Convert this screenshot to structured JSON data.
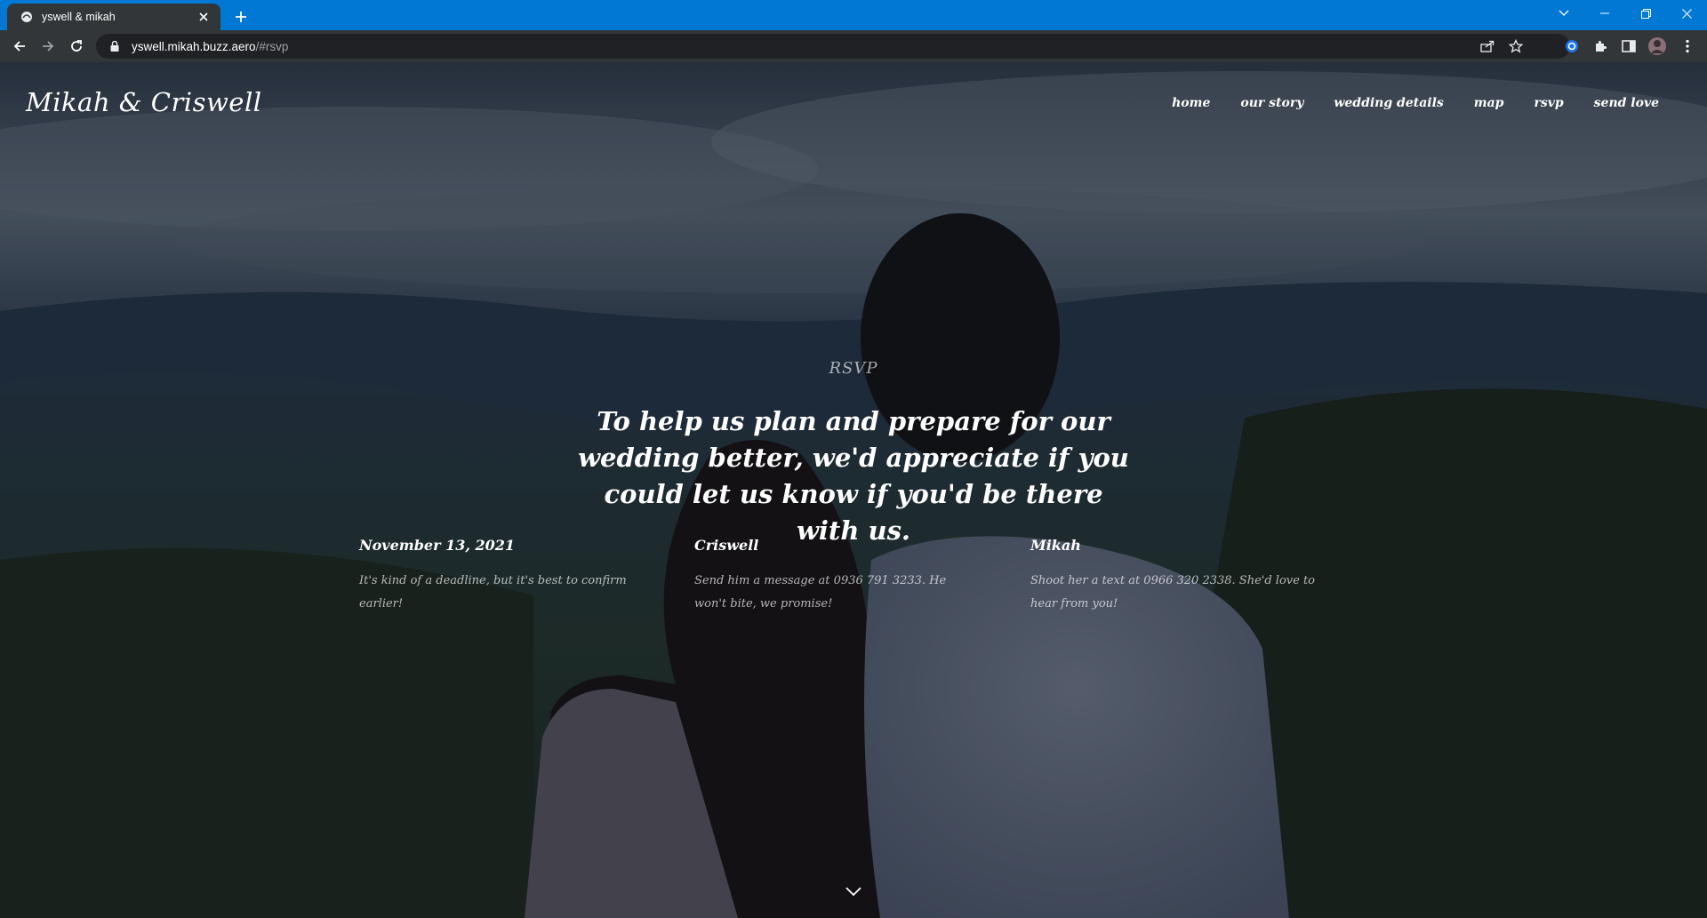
{
  "browser": {
    "tab_title": "yswell & mikah",
    "url_host": "yswell.mikah.buzz.aero",
    "url_path": "/#rsvp"
  },
  "site": {
    "brand": "Mikah & Criswell",
    "nav": [
      "home",
      "our story",
      "wedding details",
      "map",
      "rsvp",
      "send love"
    ]
  },
  "rsvp": {
    "kicker": "RSVP",
    "heading": "To help us plan and prepare for our wedding better, we'd appreciate if you could let us know if you'd be there with us.",
    "columns": [
      {
        "title": "November 13, 2021",
        "text": "It's kind of a deadline, but it's best to confirm earlier!"
      },
      {
        "title": "Criswell",
        "text": "Send him a message at 0936 791 3233. He won't bite, we promise!"
      },
      {
        "title": "Mikah",
        "text": "Shoot her a text at 0966 320 2338. She'd love to hear from you!"
      }
    ]
  },
  "colors": {
    "titlebar": "#0078d4",
    "toolbar": "#323639",
    "omnibox": "#202124",
    "overlay": "rgba(10,14,24,0.42)"
  },
  "icons": [
    "tab-favicon-icon",
    "close-icon",
    "plus-icon",
    "chevron-down-icon",
    "minimize-icon",
    "restore-icon",
    "window-close-icon",
    "back-arrow-icon",
    "forward-arrow-icon",
    "reload-icon",
    "lock-icon",
    "share-icon",
    "star-icon",
    "extension-icon",
    "puzzle-icon",
    "sidebar-icon",
    "avatar-icon",
    "kebab-menu-icon",
    "scroll-down-chevron-icon"
  ]
}
